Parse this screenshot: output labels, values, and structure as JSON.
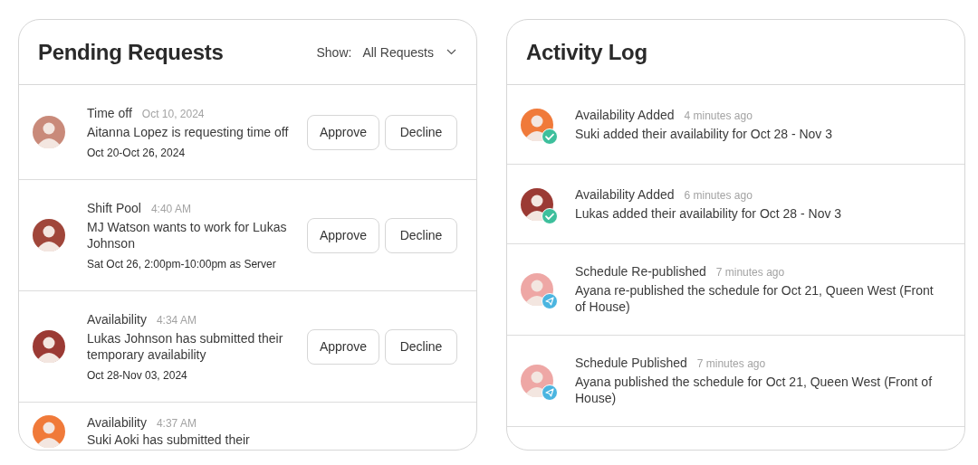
{
  "pending": {
    "title": "Pending Requests",
    "filter": {
      "label": "Show:",
      "value": "All Requests"
    },
    "requests": [
      {
        "type": "Time off",
        "time": "Oct 10, 2024",
        "description": "Aitanna Lopez is requesting time off",
        "detail": "Oct 20-Oct 26, 2024",
        "color": "#c98a7a",
        "actions": [
          "Approve",
          "Decline"
        ]
      },
      {
        "type": "Shift Pool",
        "time": "4:40 AM",
        "description": "MJ Watson wants to work for Lukas Johnson",
        "detail": "Sat Oct 26, 2:00pm-10:00pm as Server",
        "color": "#a0463a",
        "actions": [
          "Approve",
          "Decline"
        ]
      },
      {
        "type": "Availability",
        "time": "4:34 AM",
        "description": "Lukas Johnson has submitted their temporary availability",
        "detail": "Oct 28-Nov 03, 2024",
        "color": "#9b3a34",
        "actions": [
          "Approve",
          "Decline"
        ]
      },
      {
        "type": "Availability",
        "time": "4:37 AM",
        "description": "Suki Aoki has submitted their",
        "color": "#f07a3a"
      }
    ]
  },
  "activity": {
    "title": "Activity Log",
    "entries": [
      {
        "title": "Availability Added",
        "time": "4 minutes ago",
        "description": "Suki added their availability for Oct 28 - Nov 3",
        "kind": "check",
        "color": "#f07a3a"
      },
      {
        "title": "Availability Added",
        "time": "6 minutes ago",
        "description": "Lukas added their availability for Oct 28 - Nov 3",
        "kind": "check",
        "color": "#9b3a34"
      },
      {
        "title": "Schedule Re-published",
        "time": "7 minutes ago",
        "description": "Ayana re-published the schedule for Oct 21, Queen West (Front of House)",
        "kind": "send",
        "color": "#eea7a5"
      },
      {
        "title": "Schedule Published",
        "time": "7 minutes ago",
        "description": "Ayana published the schedule for Oct 21, Queen West (Front of House)",
        "kind": "send",
        "color": "#eea7a5"
      }
    ]
  }
}
